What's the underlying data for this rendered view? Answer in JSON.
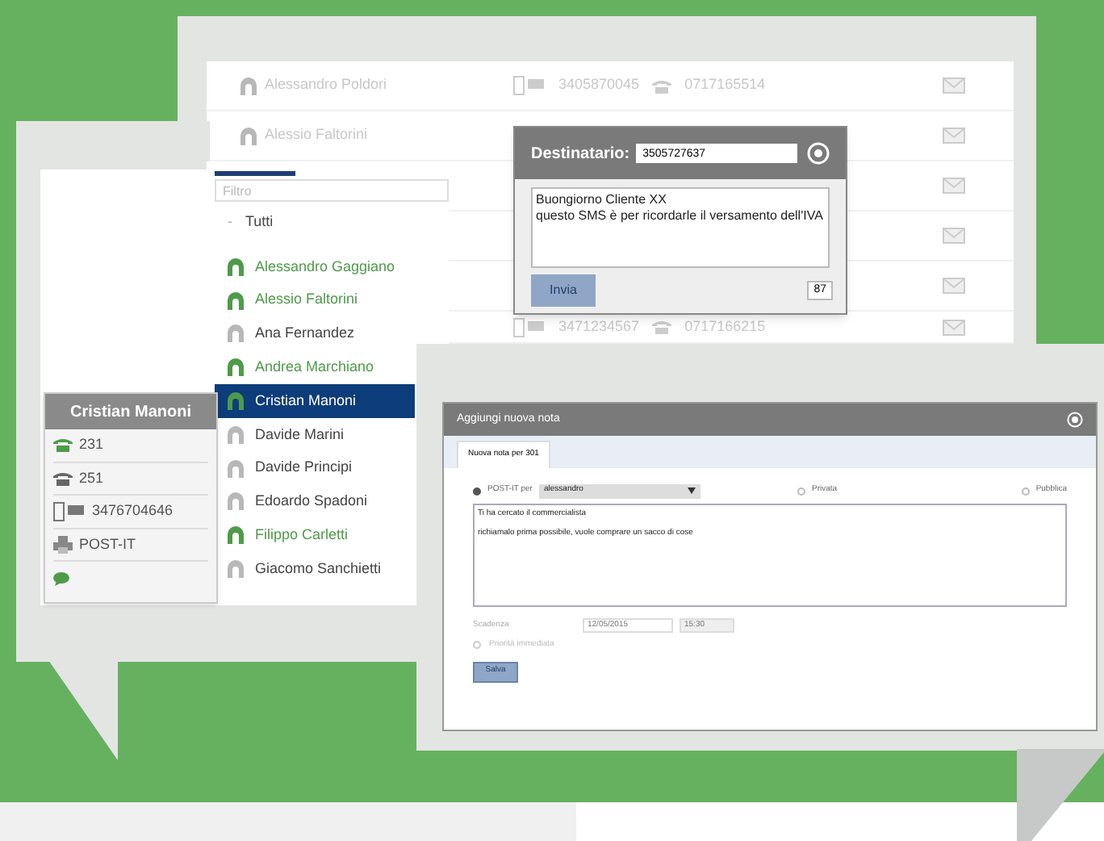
{
  "back_list": {
    "rows": [
      {
        "name": "Alessandro Poldori",
        "mobile": "3405870045",
        "phone": "0717165514"
      },
      {
        "name": "Alessio Faltorini"
      },
      {},
      {},
      {},
      {
        "mobile": "3471234567",
        "phone": "0717166215"
      }
    ]
  },
  "sms_dialog": {
    "label": "Destinatario:",
    "recipient": "3505727637",
    "message": "Buongiorno Cliente XX\nquesto SMS è per ricordarle il versamento dell'IVA",
    "send": "Invia",
    "counter": "87"
  },
  "contacts": {
    "filter_placeholder": "Filtro",
    "group_toggle": "-",
    "group": "Tutti",
    "items": [
      {
        "name": "Alessandro Gaggiano",
        "online": true,
        "selected": false
      },
      {
        "name": "Alessio Faltorini",
        "online": true,
        "selected": false
      },
      {
        "name": "Ana Fernandez",
        "online": false,
        "selected": false
      },
      {
        "name": "Andrea Marchiano",
        "online": true,
        "selected": false
      },
      {
        "name": "Cristian Manoni",
        "online": true,
        "selected": true
      },
      {
        "name": "Davide Marini",
        "online": false,
        "selected": false
      },
      {
        "name": "Davide Principi",
        "online": false,
        "selected": false
      },
      {
        "name": "Edoardo Spadoni",
        "online": false,
        "selected": false
      },
      {
        "name": "Filippo Carletti",
        "online": true,
        "selected": false
      },
      {
        "name": "Giacomo Sanchietti",
        "online": false,
        "selected": false
      }
    ]
  },
  "contact_card": {
    "title": "Cristian Manoni",
    "entries": [
      {
        "kind": "extension",
        "text": "231"
      },
      {
        "kind": "phone",
        "text": "251"
      },
      {
        "kind": "mobile",
        "text": "3476704646"
      },
      {
        "kind": "note",
        "text": "POST-IT"
      },
      {
        "kind": "chat"
      }
    ]
  },
  "note_dialog": {
    "title": "Aggiungi nuova nota",
    "tab": "Nuova nota per 301",
    "options": [
      {
        "label": "POST-IT per",
        "selected": true,
        "select": "alessandro"
      },
      {
        "label": "Privata",
        "selected": false
      },
      {
        "label": "Pubblica",
        "selected": false
      }
    ],
    "text": "Ti ha cercato il commercialista\n\nrichiamalo prima possibile, vuole comprare un sacco di cose",
    "due_label": "Scadenza",
    "date": "12/05/2015",
    "time": "15:30",
    "priority": {
      "label": "Priorità immediata",
      "checked": false
    },
    "save": "Salva"
  }
}
